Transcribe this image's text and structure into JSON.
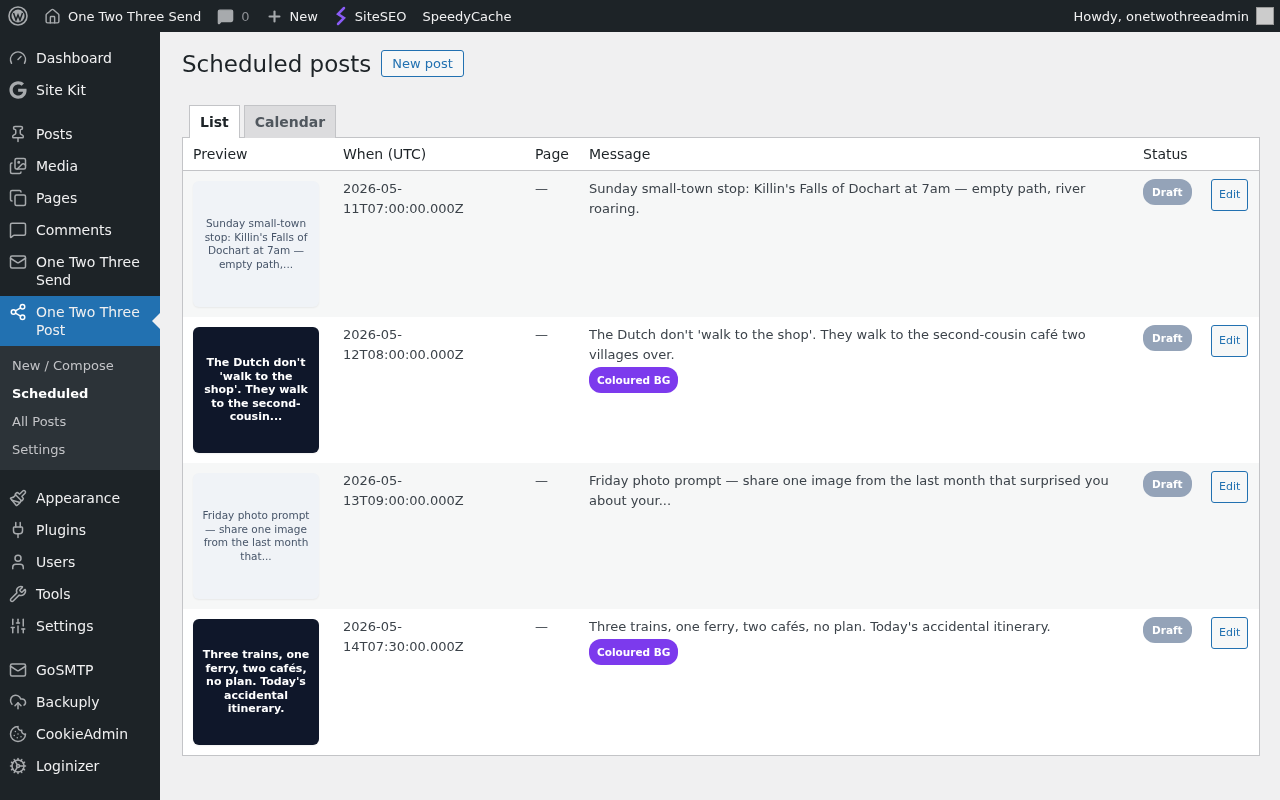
{
  "topbar": {
    "site": "One Two Three Send",
    "comments": "0",
    "new": "New",
    "plugins": [
      "SiteSEO",
      "SpeedyCache"
    ],
    "greeting": "Howdy, onetwothreeadmin"
  },
  "sidebar": {
    "groups": [
      [
        {
          "label": "Dashboard",
          "selected": false
        },
        {
          "label": "Site Kit",
          "selected": false
        }
      ],
      [
        {
          "label": "Posts",
          "selected": false
        },
        {
          "label": "Media",
          "selected": false
        },
        {
          "label": "Pages",
          "selected": false
        },
        {
          "label": "Comments",
          "selected": false
        },
        {
          "label": "One Two Three Send",
          "selected": false
        },
        {
          "label": "One Two Three Post",
          "selected": true,
          "children": [
            {
              "label": "New / Compose",
              "selected": false
            },
            {
              "label": "Scheduled",
              "selected": true
            },
            {
              "label": "All Posts",
              "selected": false
            },
            {
              "label": "Settings",
              "selected": false
            }
          ]
        }
      ],
      [
        {
          "label": "Appearance",
          "selected": false
        },
        {
          "label": "Plugins",
          "selected": false
        },
        {
          "label": "Users",
          "selected": false
        },
        {
          "label": "Tools",
          "selected": false
        },
        {
          "label": "Settings",
          "selected": false
        }
      ],
      [
        {
          "label": "GoSMTP",
          "selected": false
        },
        {
          "label": "Backuply",
          "selected": false
        },
        {
          "label": "CookieAdmin",
          "selected": false
        },
        {
          "label": "Loginizer",
          "selected": false
        }
      ]
    ]
  },
  "page": {
    "title": "Scheduled posts",
    "new_button": "New post"
  },
  "tabs": [
    {
      "label": "List",
      "selected": true
    },
    {
      "label": "Calendar",
      "selected": false
    }
  ],
  "table": {
    "columns": [
      "Preview",
      "When (UTC)",
      "Page",
      "Message",
      "Status"
    ],
    "rows": [
      {
        "preview": {
          "kind": "plain",
          "text": "Sunday small-town stop: Killin's Falls of Dochart at 7am — empty path,..."
        },
        "when": "2026-05-11T07:00:00.000Z",
        "page": "—",
        "message": "Sunday small-town stop: Killin's Falls of Dochart at 7am — empty path, river roaring.",
        "status": "Draft",
        "action": "Edit"
      },
      {
        "preview": {
          "kind": "coloured",
          "text": "The Dutch don't 'walk to the shop'. They walk to the second-cousin..."
        },
        "when": "2026-05-12T08:00:00.000Z",
        "page": "—",
        "message": "The Dutch don't 'walk to the shop'. They walk to the second-cousin café two villages over.",
        "tag": "Coloured BG",
        "status": "Draft",
        "action": "Edit"
      },
      {
        "preview": {
          "kind": "plain",
          "text": "Friday photo prompt — share one image from the last month that..."
        },
        "when": "2026-05-13T09:00:00.000Z",
        "page": "—",
        "message": "Friday photo prompt — share one image from the last month that surprised you about your...",
        "status": "Draft",
        "action": "Edit"
      },
      {
        "preview": {
          "kind": "coloured",
          "text": "Three trains, one ferry, two cafés, no plan. Today's accidental itinerary."
        },
        "when": "2026-05-14T07:30:00.000Z",
        "page": "—",
        "message": "Three trains, one ferry, two cafés, no plan. Today's accidental itinerary.",
        "tag": "Coloured BG",
        "status": "Draft",
        "action": "Edit"
      }
    ]
  }
}
